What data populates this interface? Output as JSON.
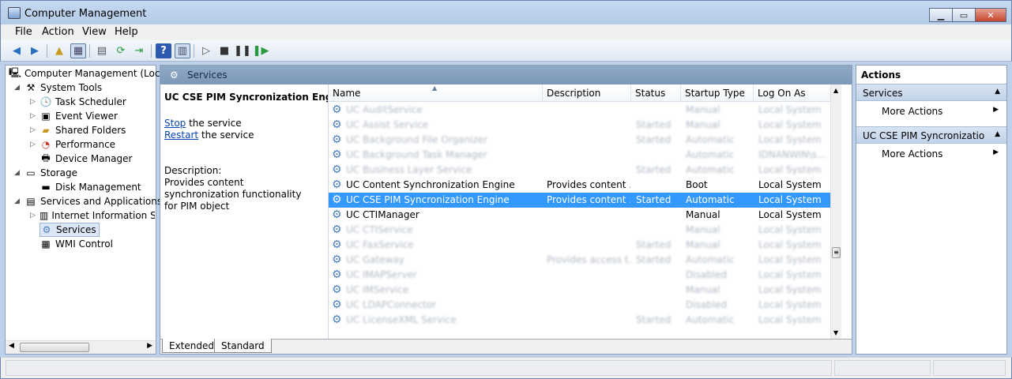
{
  "window": {
    "title": "Computer Management"
  },
  "menu": [
    "File",
    "Action",
    "View",
    "Help"
  ],
  "tree": {
    "root": "Computer Management (Local)",
    "system_tools": "System Tools",
    "task_scheduler": "Task Scheduler",
    "event_viewer": "Event Viewer",
    "shared_folders": "Shared Folders",
    "performance": "Performance",
    "device_manager": "Device Manager",
    "storage": "Storage",
    "disk_management": "Disk Management",
    "services_apps": "Services and Applications",
    "iis": "Internet Information Services",
    "services": "Services",
    "wmi": "WMI Control"
  },
  "center": {
    "header": "Services",
    "detail": {
      "service_name": "UC CSE PIM Syncronization Engine",
      "stop_link": "Stop",
      "stop_rest": " the service",
      "restart_link": "Restart",
      "restart_rest": " the service",
      "desc_label": "Description:",
      "desc_text": "Provides content synchronization functionality for PIM object"
    },
    "columns": [
      "Name",
      "Description",
      "Status",
      "Startup Type",
      "Log On As"
    ],
    "rows": [
      {
        "name": "UC AuditService",
        "desc": "",
        "status": "",
        "startup": "Manual",
        "logon": "Local System",
        "blur": true
      },
      {
        "name": "UC Assist Service",
        "desc": "",
        "status": "Started",
        "startup": "Manual",
        "logon": "Local System",
        "blur": true
      },
      {
        "name": "UC Background File Organizer",
        "desc": "",
        "status": "Started",
        "startup": "Automatic",
        "logon": "Local System",
        "blur": true
      },
      {
        "name": "UC Background Task Manager",
        "desc": "",
        "status": "",
        "startup": "Automatic",
        "logon": "IDNANWIN\\s...",
        "blur": true
      },
      {
        "name": "UC Business Layer Service",
        "desc": "",
        "status": "Started",
        "startup": "Automatic",
        "logon": "Local System",
        "blur": true
      },
      {
        "name": "UC Content Synchronization Engine",
        "desc": "Provides content ...",
        "status": "",
        "startup": "Boot",
        "logon": "Local System",
        "blur": false
      },
      {
        "name": "UC CSE PIM Syncronization Engine",
        "desc": "Provides content ...",
        "status": "Started",
        "startup": "Automatic",
        "logon": "Local System",
        "blur": false,
        "selected": true
      },
      {
        "name": "UC CTIManager",
        "desc": "",
        "status": "",
        "startup": "Manual",
        "logon": "Local System",
        "blur": false
      },
      {
        "name": "UC CTIService",
        "desc": "",
        "status": "",
        "startup": "Manual",
        "logon": "Local System",
        "blur": true
      },
      {
        "name": "UC FaxService",
        "desc": "",
        "status": "Started",
        "startup": "Manual",
        "logon": "Local System",
        "blur": true
      },
      {
        "name": "UC Gateway",
        "desc": "Provides access t...",
        "status": "Started",
        "startup": "Automatic",
        "logon": "Local System",
        "blur": true
      },
      {
        "name": "UC IMAPServer",
        "desc": "",
        "status": "",
        "startup": "Disabled",
        "logon": "Local System",
        "blur": true
      },
      {
        "name": "UC IMService",
        "desc": "",
        "status": "",
        "startup": "Manual",
        "logon": "Local System",
        "blur": true
      },
      {
        "name": "UC LDAPConnector",
        "desc": "",
        "status": "",
        "startup": "Disabled",
        "logon": "Local System",
        "blur": true
      },
      {
        "name": "UC LicenseXML Service",
        "desc": "",
        "status": "Started",
        "startup": "Automatic",
        "logon": "Local System",
        "blur": true
      }
    ],
    "tabs": [
      "Extended",
      "Standard"
    ]
  },
  "actions": {
    "header": "Actions",
    "section1": "Services",
    "more1": "More Actions",
    "section2": "UC CSE PIM Syncronization ...",
    "more2": "More Actions"
  },
  "colors": {
    "selection": "#3399ff",
    "link": "#0645ad"
  }
}
